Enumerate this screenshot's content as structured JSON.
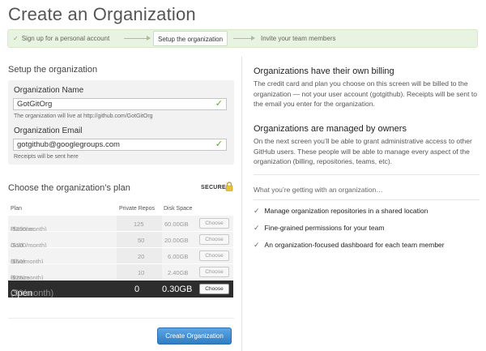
{
  "page": {
    "title": "Create an Organization"
  },
  "steps": {
    "step1": "Sign up for a personal account",
    "step2": "Setup the organization",
    "step3": "Invite your team members"
  },
  "setup": {
    "heading": "Setup the organization",
    "name_label": "Organization Name",
    "name_value": "GotGitOrg",
    "name_note": "The organization will live at http://github.com/GotGitOrg",
    "email_label": "Organization Email",
    "email_value": "gotgithub@googlegroups.com",
    "email_note": "Receipts will be sent here"
  },
  "plans": {
    "heading": "Choose the organization’s plan",
    "secure_label": "SECURE",
    "columns": {
      "plan": "Plan",
      "repos": "Private Repos",
      "disk": "Disk Space"
    },
    "choose_label": "Choose",
    "rows": [
      {
        "name": "Platinum",
        "price": "($200/month)",
        "repos": "125",
        "disk": "60.00GB"
      },
      {
        "name": "Gold",
        "price": "($100/month)",
        "repos": "50",
        "disk": "20.00GB"
      },
      {
        "name": "Silver",
        "price": "($50/month)",
        "repos": "20",
        "disk": "6.00GB"
      },
      {
        "name": "Bronze",
        "price": "($25/month)",
        "repos": "10",
        "disk": "2.40GB"
      },
      {
        "name": "Open Source",
        "price": "($0/month)",
        "repos": "0",
        "disk": "0.30GB"
      }
    ],
    "create_button": "Create Organization"
  },
  "info": {
    "billing_heading": "Organizations have their own billing",
    "billing_text": "The credit card and plan you choose on this screen will be billed to the organization — not your user account (gotgithub). Receipts will be sent to the email you enter for the organization.",
    "owners_heading": "Organizations are managed by owners",
    "owners_text": "On the next screen you’ll be able to grant administrative access to other GitHub users. These people will be able to manage every aspect of the organization (billing, repositories, teams, etc).",
    "intro": "What you’re getting with an organization…",
    "benefits": [
      "Manage organization repositories in a shared location",
      "Fine-grained permissions for your team",
      "An organization-focused dashboard for each team member"
    ]
  },
  "colors": {
    "accent": "#3f8fd5",
    "success": "#5ca43a",
    "selected_row": "#2d2d2d",
    "steps_bg": "#e8f3e1"
  }
}
